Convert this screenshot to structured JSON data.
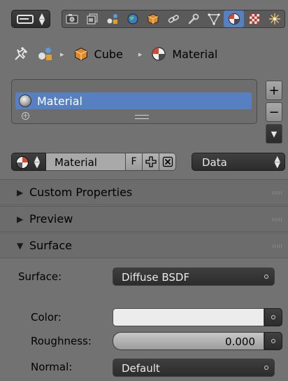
{
  "toolbar": {
    "tabs": [
      {
        "name": "render-icon"
      },
      {
        "name": "render-layers-icon"
      },
      {
        "name": "scene-icon"
      },
      {
        "name": "world-icon"
      },
      {
        "name": "object-icon"
      },
      {
        "name": "constraints-icon"
      },
      {
        "name": "modifiers-icon"
      },
      {
        "name": "mesh-data-icon"
      },
      {
        "name": "material-icon",
        "active": true
      },
      {
        "name": "texture-icon"
      },
      {
        "name": "particles-icon"
      }
    ],
    "active_color": "#5680c2"
  },
  "breadcrumb": {
    "items": [
      "Cube",
      "Material"
    ]
  },
  "material_slots": {
    "items": [
      {
        "label": "Material",
        "selected": true
      }
    ],
    "add_label": "+",
    "remove_label": "−"
  },
  "datablock": {
    "name": "Material",
    "fake_user_label": "F",
    "link_label": "Data"
  },
  "panels": {
    "custom_properties": "Custom Properties",
    "preview": "Preview",
    "surface": "Surface"
  },
  "surface": {
    "surface_label": "Surface:",
    "surface_value": "Diffuse BSDF",
    "color_label": "Color:",
    "color_value": "#ececec",
    "roughness_label": "Roughness:",
    "roughness_value": "0.000",
    "normal_label": "Normal:",
    "normal_value": "Default"
  }
}
